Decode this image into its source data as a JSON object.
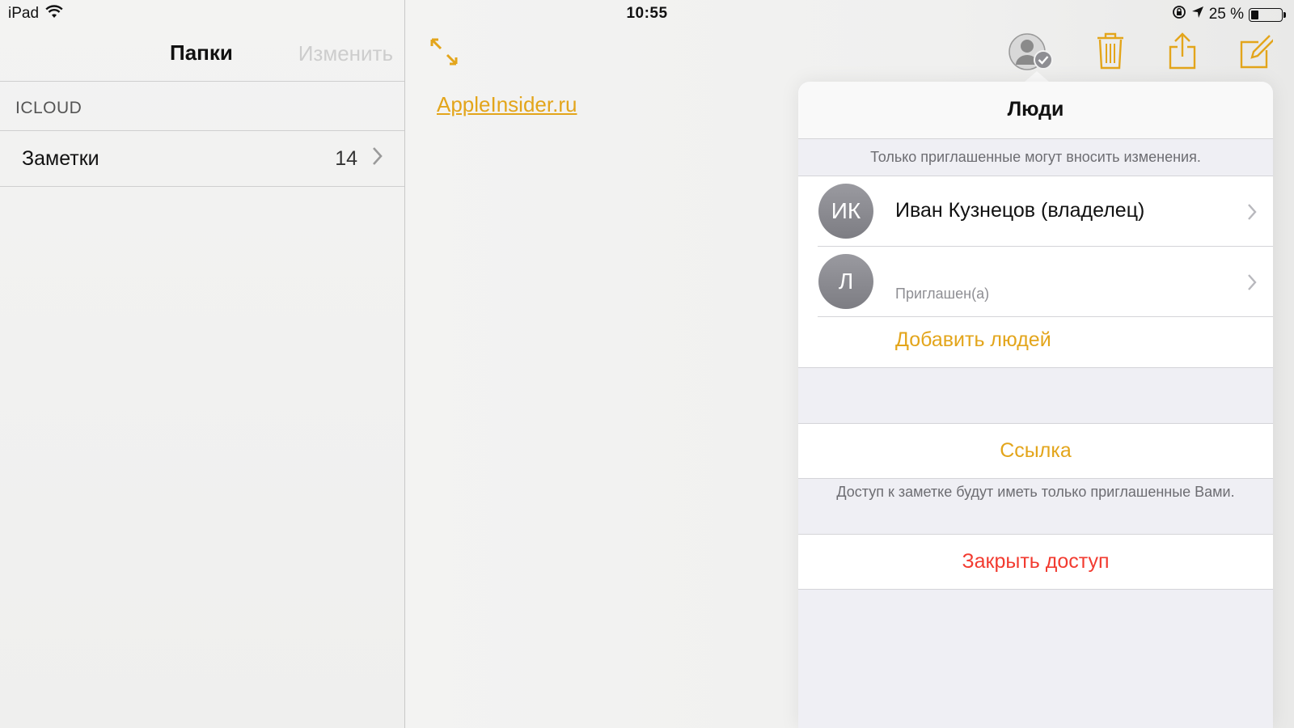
{
  "status_bar": {
    "device": "iPad",
    "time": "10:55",
    "battery_label": "25 %",
    "battery_level": 0.25
  },
  "sidebar": {
    "title": "Папки",
    "edit_label": "Изменить",
    "section_header": "ICLOUD",
    "folders": [
      {
        "label": "Заметки",
        "count": "14"
      }
    ]
  },
  "note": {
    "link_text": "AppleInsider.ru"
  },
  "toolbar": {
    "icons": [
      "people-share-icon",
      "trash-icon",
      "share-icon",
      "compose-icon"
    ]
  },
  "popover": {
    "title": "Люди",
    "hint_top": "Только приглашенные могут вносить изменения.",
    "people": [
      {
        "initials": "ИК",
        "name": "Иван Кузнецов (владелец)",
        "status": ""
      },
      {
        "initials": "Л",
        "name": "",
        "status": "Приглашен(а)"
      }
    ],
    "add_people_label": "Добавить людей",
    "link_label": "Ссылка",
    "hint_bottom": "Доступ к заметке будут иметь только приглашенные Вами.",
    "stop_sharing_label": "Закрыть доступ"
  },
  "colors": {
    "accent": "#e3a51b",
    "destructive": "#f23b30"
  }
}
